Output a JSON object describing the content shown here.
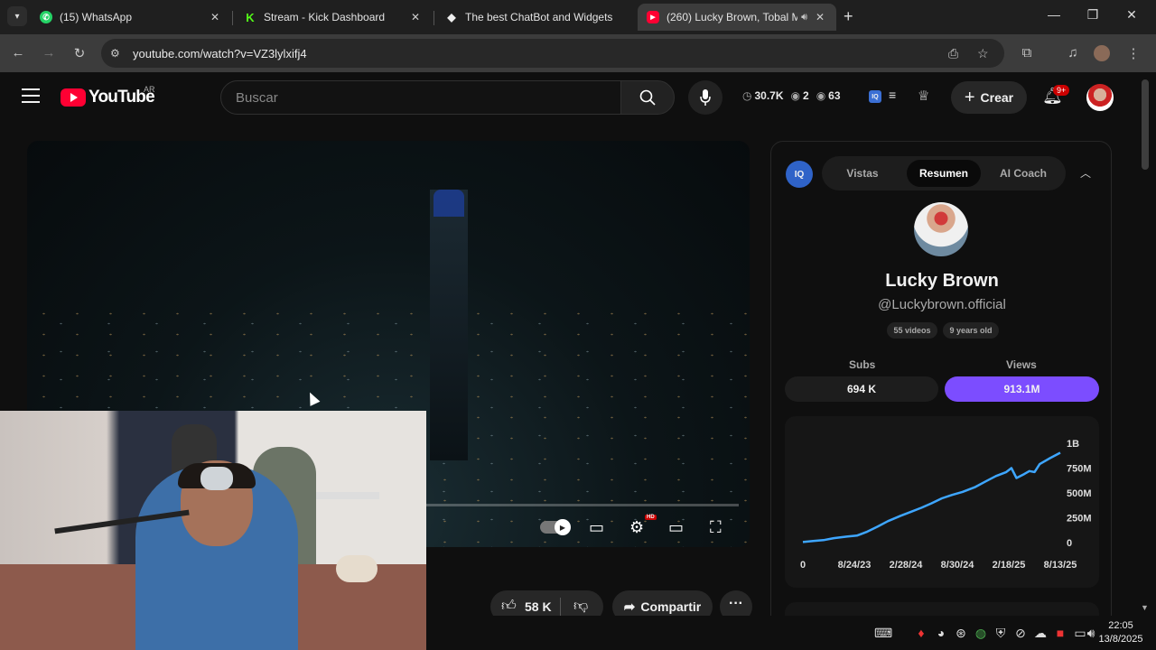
{
  "browser": {
    "tabs": [
      {
        "title": "(15) WhatsApp",
        "favicon": "whatsapp-icon"
      },
      {
        "title": "Stream - Kick Dashboard",
        "favicon": "kick-icon"
      },
      {
        "title": "The best ChatBot and Widgets",
        "favicon": "diamond-icon"
      },
      {
        "title": "(260) Lucky Brown, Tobal M",
        "favicon": "youtube-icon",
        "active": true
      }
    ],
    "url": "youtube.com/watch?v=VZ3lylxifj4"
  },
  "youtube": {
    "logo_text": "YouTube",
    "country": "AR",
    "search_placeholder": "Buscar",
    "stats": {
      "time": "30.7K",
      "watching": "2",
      "views": "63"
    },
    "create_label": "Crear",
    "notifications": "9+"
  },
  "video_actions": {
    "likes": "58 K",
    "share_label": "Compartir"
  },
  "panel": {
    "tabs": [
      "Vistas",
      "Resumen",
      "AI Coach"
    ],
    "active_tab": "Resumen",
    "iq_label": "IQ",
    "channel_name": "Lucky Brown",
    "handle": "@Luckybrown.official",
    "videos_chip": "55 videos",
    "age_chip": "9 years old",
    "subs_label": "Subs",
    "views_label": "Views",
    "subs_value": "694 K",
    "views_value": "913.1M",
    "accent": "#7c4dff"
  },
  "chart_data": {
    "type": "line",
    "x_ticks": [
      "0",
      "8/24/23",
      "2/28/24",
      "8/30/24",
      "2/18/25",
      "8/13/25"
    ],
    "y_ticks": [
      "0",
      "250M",
      "500M",
      "750M",
      "1B"
    ],
    "ylim": [
      0,
      1000000000
    ],
    "series": [
      {
        "color": "#3ea6ff",
        "points": [
          [
            0,
            5
          ],
          [
            0.04,
            15
          ],
          [
            0.08,
            25
          ],
          [
            0.12,
            45
          ],
          [
            0.17,
            60
          ],
          [
            0.21,
            70
          ],
          [
            0.25,
            110
          ],
          [
            0.29,
            160
          ],
          [
            0.33,
            215
          ],
          [
            0.38,
            270
          ],
          [
            0.42,
            310
          ],
          [
            0.46,
            350
          ],
          [
            0.5,
            395
          ],
          [
            0.54,
            445
          ],
          [
            0.58,
            480
          ],
          [
            0.62,
            510
          ],
          [
            0.67,
            560
          ],
          [
            0.71,
            615
          ],
          [
            0.75,
            670
          ],
          [
            0.79,
            710
          ],
          [
            0.81,
            750
          ],
          [
            0.83,
            650
          ],
          [
            0.86,
            690
          ],
          [
            0.88,
            720
          ],
          [
            0.9,
            710
          ],
          [
            0.92,
            790
          ],
          [
            0.96,
            850
          ],
          [
            1.0,
            905
          ]
        ],
        "units": "million views vs fraction of date range"
      }
    ]
  },
  "taskbar": {
    "time": "22:05",
    "date": "13/8/2025"
  }
}
